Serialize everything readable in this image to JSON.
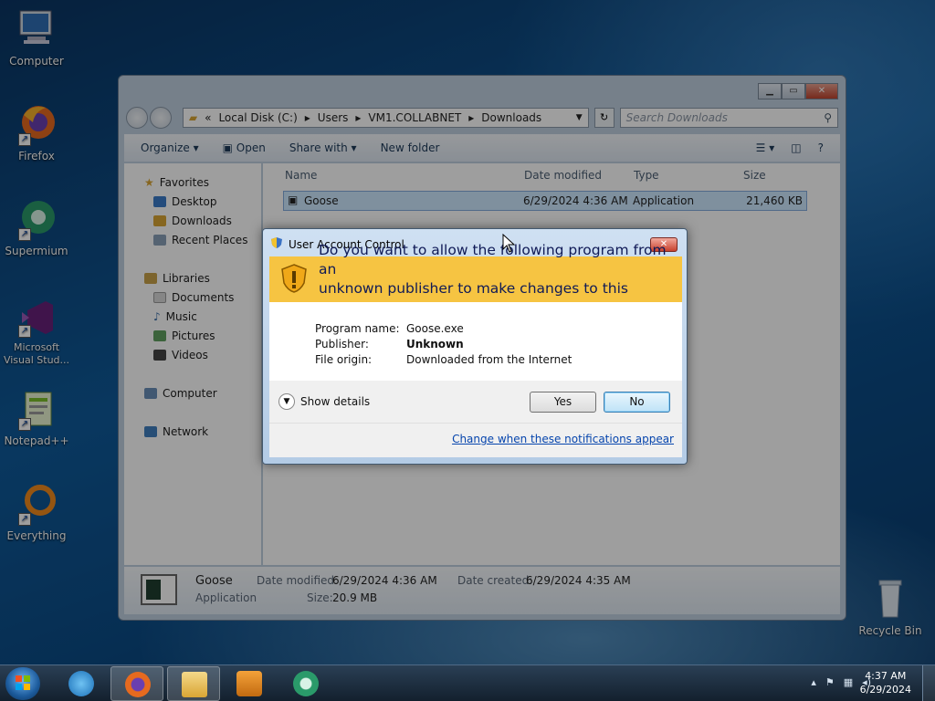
{
  "desktop": {
    "icons": [
      {
        "label": "Computer",
        "icon": "computer-icon"
      },
      {
        "label": "Firefox",
        "icon": "firefox-icon"
      },
      {
        "label": "Supermium",
        "icon": "supermium-icon"
      },
      {
        "label": "Microsoft Visual Stud...",
        "icon": "visual-studio-icon"
      },
      {
        "label": "Notepad++",
        "icon": "notepadpp-icon"
      },
      {
        "label": "Everything",
        "icon": "everything-icon"
      },
      {
        "label": "Recycle Bin",
        "icon": "recycle-bin-icon"
      }
    ]
  },
  "explorer": {
    "address": [
      "Local Disk (C:)",
      "Users",
      "VM1.COLLABNET",
      "Downloads"
    ],
    "address_prefix": "«",
    "search_placeholder": "Search Downloads",
    "toolbar": {
      "organize": "Organize ▾",
      "open": "Open",
      "share_with": "Share with ▾",
      "new_folder": "New folder"
    },
    "nav": {
      "favorites": "Favorites",
      "desktop": "Desktop",
      "downloads": "Downloads",
      "recent_places": "Recent Places",
      "libraries": "Libraries",
      "documents": "Documents",
      "music": "Music",
      "pictures": "Pictures",
      "videos": "Videos",
      "computer": "Computer",
      "network": "Network"
    },
    "columns": {
      "name": "Name",
      "date_modified": "Date modified",
      "type": "Type",
      "size": "Size"
    },
    "file": {
      "name": "Goose",
      "date_modified": "6/29/2024 4:36 AM",
      "type": "Application",
      "size": "21,460 KB"
    },
    "details": {
      "name": "Goose",
      "kind": "Application",
      "date_modified_label": "Date modified:",
      "date_modified": "6/29/2024 4:36 AM",
      "date_created_label": "Date created:",
      "date_created": "6/29/2024 4:35 AM",
      "size_label": "Size:",
      "size": "20.9 MB"
    }
  },
  "uac": {
    "title": "User Account Control",
    "question_line1": "Do you want to allow the following program from an",
    "question_line2": "unknown publisher to make changes to this computer?",
    "program_name_label": "Program name:",
    "program_name": "Goose.exe",
    "publisher_label": "Publisher:",
    "publisher": "Unknown",
    "file_origin_label": "File origin:",
    "file_origin": "Downloaded from the Internet",
    "show_details": "Show details",
    "yes": "Yes",
    "no": "No",
    "link": "Change when these notifications appear",
    "banner_color": "#f6c442"
  },
  "taskbar": {
    "time": "4:37 AM",
    "date": "6/29/2024"
  }
}
